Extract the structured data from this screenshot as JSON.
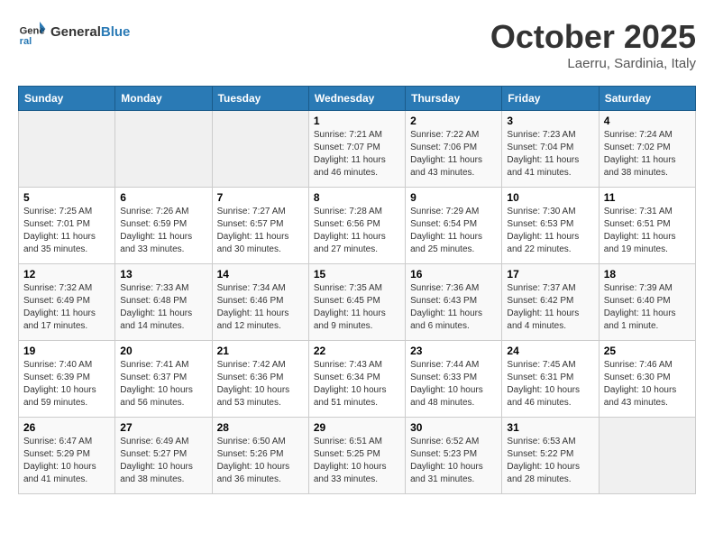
{
  "header": {
    "logo_line1": "General",
    "logo_line2": "Blue",
    "month": "October 2025",
    "location": "Laerru, Sardinia, Italy"
  },
  "days_of_week": [
    "Sunday",
    "Monday",
    "Tuesday",
    "Wednesday",
    "Thursday",
    "Friday",
    "Saturday"
  ],
  "weeks": [
    [
      {
        "day": "",
        "sunrise": "",
        "sunset": "",
        "daylight": ""
      },
      {
        "day": "",
        "sunrise": "",
        "sunset": "",
        "daylight": ""
      },
      {
        "day": "",
        "sunrise": "",
        "sunset": "",
        "daylight": ""
      },
      {
        "day": "1",
        "sunrise": "7:21 AM",
        "sunset": "7:07 PM",
        "daylight": "11 hours and 46 minutes."
      },
      {
        "day": "2",
        "sunrise": "7:22 AM",
        "sunset": "7:06 PM",
        "daylight": "11 hours and 43 minutes."
      },
      {
        "day": "3",
        "sunrise": "7:23 AM",
        "sunset": "7:04 PM",
        "daylight": "11 hours and 41 minutes."
      },
      {
        "day": "4",
        "sunrise": "7:24 AM",
        "sunset": "7:02 PM",
        "daylight": "11 hours and 38 minutes."
      }
    ],
    [
      {
        "day": "5",
        "sunrise": "7:25 AM",
        "sunset": "7:01 PM",
        "daylight": "11 hours and 35 minutes."
      },
      {
        "day": "6",
        "sunrise": "7:26 AM",
        "sunset": "6:59 PM",
        "daylight": "11 hours and 33 minutes."
      },
      {
        "day": "7",
        "sunrise": "7:27 AM",
        "sunset": "6:57 PM",
        "daylight": "11 hours and 30 minutes."
      },
      {
        "day": "8",
        "sunrise": "7:28 AM",
        "sunset": "6:56 PM",
        "daylight": "11 hours and 27 minutes."
      },
      {
        "day": "9",
        "sunrise": "7:29 AM",
        "sunset": "6:54 PM",
        "daylight": "11 hours and 25 minutes."
      },
      {
        "day": "10",
        "sunrise": "7:30 AM",
        "sunset": "6:53 PM",
        "daylight": "11 hours and 22 minutes."
      },
      {
        "day": "11",
        "sunrise": "7:31 AM",
        "sunset": "6:51 PM",
        "daylight": "11 hours and 19 minutes."
      }
    ],
    [
      {
        "day": "12",
        "sunrise": "7:32 AM",
        "sunset": "6:49 PM",
        "daylight": "11 hours and 17 minutes."
      },
      {
        "day": "13",
        "sunrise": "7:33 AM",
        "sunset": "6:48 PM",
        "daylight": "11 hours and 14 minutes."
      },
      {
        "day": "14",
        "sunrise": "7:34 AM",
        "sunset": "6:46 PM",
        "daylight": "11 hours and 12 minutes."
      },
      {
        "day": "15",
        "sunrise": "7:35 AM",
        "sunset": "6:45 PM",
        "daylight": "11 hours and 9 minutes."
      },
      {
        "day": "16",
        "sunrise": "7:36 AM",
        "sunset": "6:43 PM",
        "daylight": "11 hours and 6 minutes."
      },
      {
        "day": "17",
        "sunrise": "7:37 AM",
        "sunset": "6:42 PM",
        "daylight": "11 hours and 4 minutes."
      },
      {
        "day": "18",
        "sunrise": "7:39 AM",
        "sunset": "6:40 PM",
        "daylight": "11 hours and 1 minute."
      }
    ],
    [
      {
        "day": "19",
        "sunrise": "7:40 AM",
        "sunset": "6:39 PM",
        "daylight": "10 hours and 59 minutes."
      },
      {
        "day": "20",
        "sunrise": "7:41 AM",
        "sunset": "6:37 PM",
        "daylight": "10 hours and 56 minutes."
      },
      {
        "day": "21",
        "sunrise": "7:42 AM",
        "sunset": "6:36 PM",
        "daylight": "10 hours and 53 minutes."
      },
      {
        "day": "22",
        "sunrise": "7:43 AM",
        "sunset": "6:34 PM",
        "daylight": "10 hours and 51 minutes."
      },
      {
        "day": "23",
        "sunrise": "7:44 AM",
        "sunset": "6:33 PM",
        "daylight": "10 hours and 48 minutes."
      },
      {
        "day": "24",
        "sunrise": "7:45 AM",
        "sunset": "6:31 PM",
        "daylight": "10 hours and 46 minutes."
      },
      {
        "day": "25",
        "sunrise": "7:46 AM",
        "sunset": "6:30 PM",
        "daylight": "10 hours and 43 minutes."
      }
    ],
    [
      {
        "day": "26",
        "sunrise": "6:47 AM",
        "sunset": "5:29 PM",
        "daylight": "10 hours and 41 minutes."
      },
      {
        "day": "27",
        "sunrise": "6:49 AM",
        "sunset": "5:27 PM",
        "daylight": "10 hours and 38 minutes."
      },
      {
        "day": "28",
        "sunrise": "6:50 AM",
        "sunset": "5:26 PM",
        "daylight": "10 hours and 36 minutes."
      },
      {
        "day": "29",
        "sunrise": "6:51 AM",
        "sunset": "5:25 PM",
        "daylight": "10 hours and 33 minutes."
      },
      {
        "day": "30",
        "sunrise": "6:52 AM",
        "sunset": "5:23 PM",
        "daylight": "10 hours and 31 minutes."
      },
      {
        "day": "31",
        "sunrise": "6:53 AM",
        "sunset": "5:22 PM",
        "daylight": "10 hours and 28 minutes."
      },
      {
        "day": "",
        "sunrise": "",
        "sunset": "",
        "daylight": ""
      }
    ]
  ]
}
